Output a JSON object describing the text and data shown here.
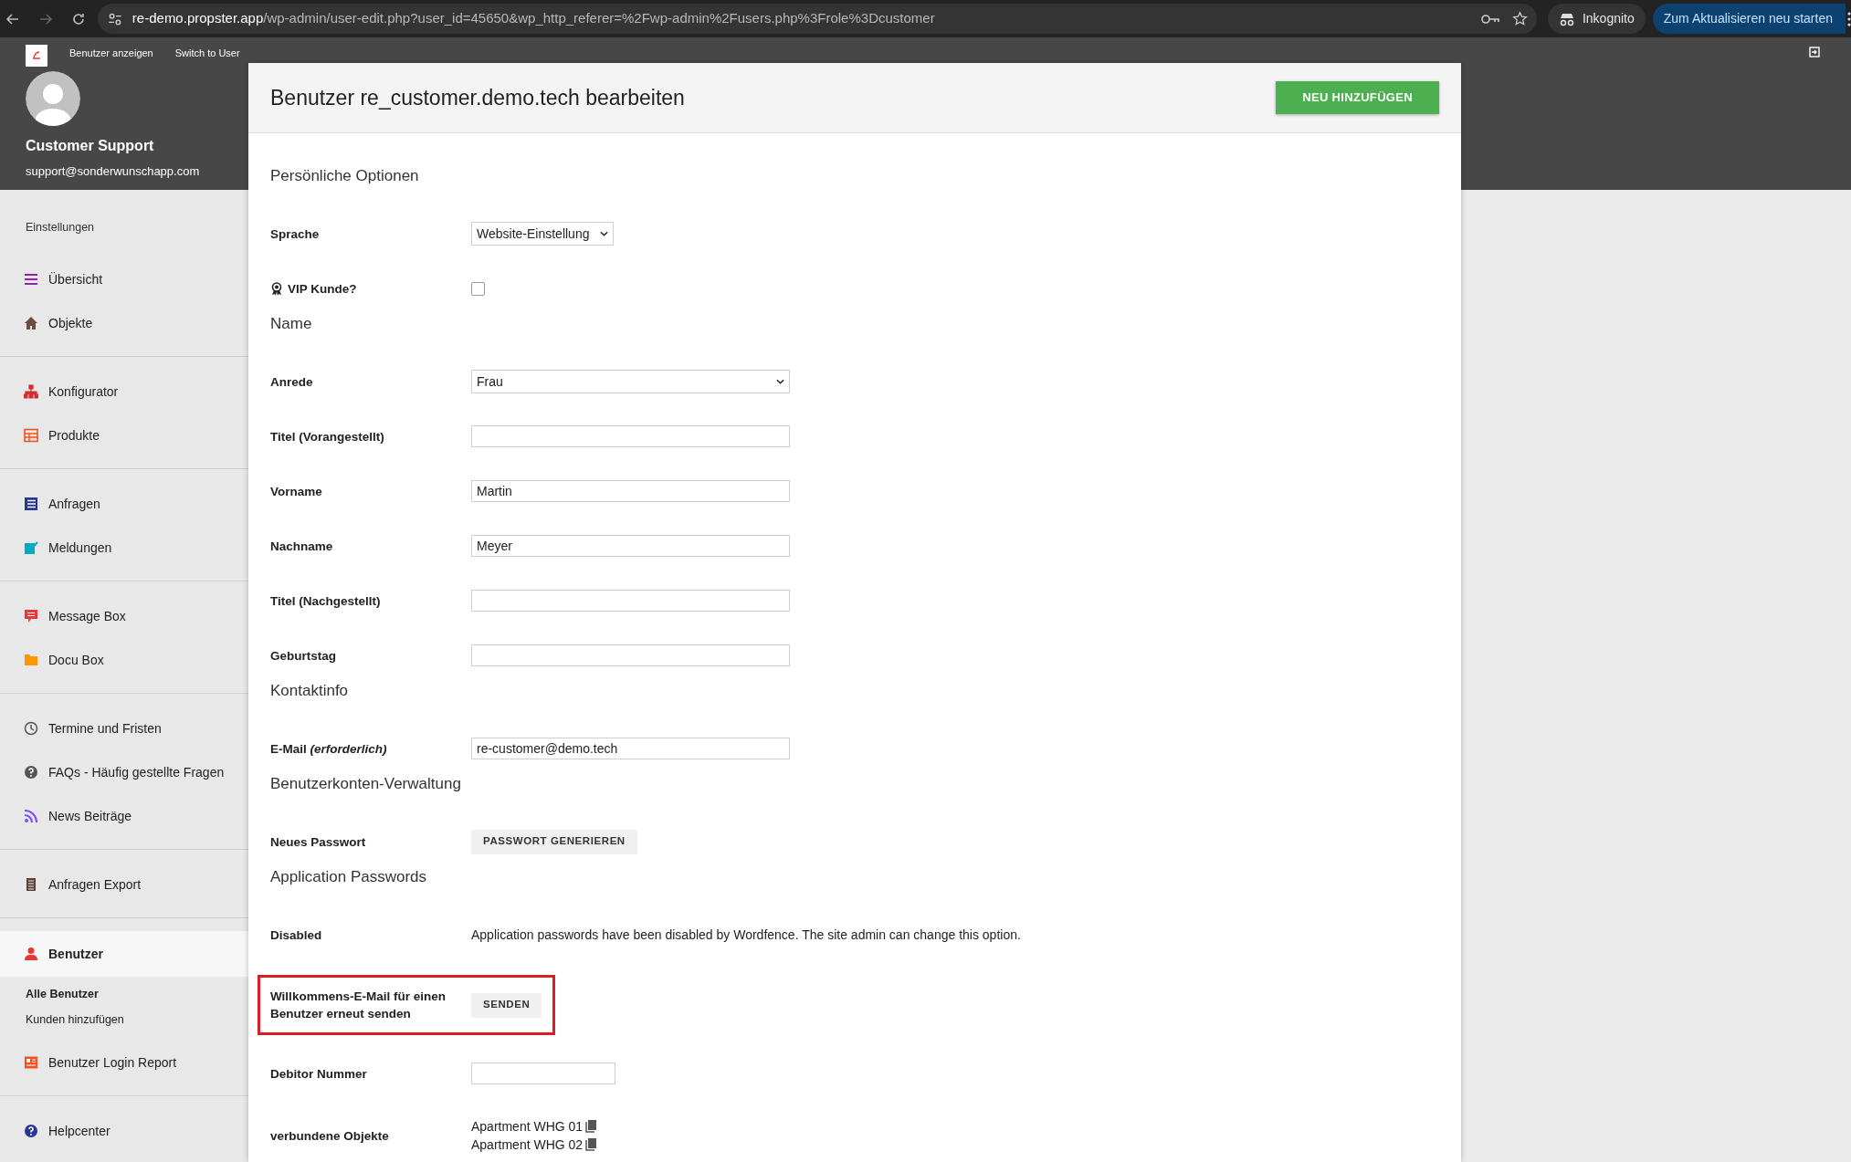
{
  "browser": {
    "url_host": "re-demo.propster.app",
    "url_path": "/wp-admin/user-edit.php?user_id=45650&wp_http_referer=%2Fwp-admin%2Fusers.php%3Frole%3Dcustomer",
    "profile_label": "Inkognito",
    "update_button": "Zum Aktualisieren neu starten"
  },
  "admin_bar": {
    "links": [
      "Benutzer anzeigen",
      "Switch to User"
    ]
  },
  "profile": {
    "name": "Customer Support",
    "email": "support@sonderwunschapp.com"
  },
  "sidebar": {
    "heading": "Einstellungen",
    "groups": [
      [
        {
          "label": "Übersicht",
          "selected": false
        },
        {
          "label": "Objekte",
          "selected": false
        }
      ],
      [
        {
          "label": "Konfigurator",
          "selected": false
        },
        {
          "label": "Produkte",
          "selected": false
        }
      ],
      [
        {
          "label": "Anfragen",
          "selected": false
        },
        {
          "label": "Meldungen",
          "selected": false
        }
      ],
      [
        {
          "label": "Message Box",
          "selected": false
        },
        {
          "label": "Docu Box",
          "selected": false
        }
      ],
      [
        {
          "label": "Termine und Fristen",
          "selected": false
        },
        {
          "label": "FAQs - Häufig gestellte Fragen",
          "selected": false
        },
        {
          "label": "News Beiträge",
          "selected": false
        }
      ],
      [
        {
          "label": "Anfragen Export",
          "selected": false
        }
      ],
      [
        {
          "label": "Benutzer",
          "selected": true,
          "children": [
            {
              "label": "Alle Benutzer",
              "selected": true
            },
            {
              "label": "Kunden hinzufügen",
              "selected": false
            }
          ]
        },
        {
          "label": "Benutzer Login Report",
          "selected": false
        }
      ],
      [
        {
          "label": "Helpcenter",
          "selected": false
        }
      ]
    ]
  },
  "page": {
    "title": "Benutzer re_customer.demo.tech bearbeiten",
    "add_button": "NEU HINZUFÜGEN"
  },
  "form": [
    {
      "kind": "heading",
      "text": "Persönliche Optionen"
    },
    {
      "kind": "dropdown",
      "label": "Sprache",
      "value": "Website-Einstellung"
    },
    {
      "kind": "checkbox",
      "label": "VIP Kunde?",
      "checked": false
    },
    {
      "kind": "heading",
      "text": "Name"
    },
    {
      "kind": "select",
      "label": "Anrede",
      "value": "Frau"
    },
    {
      "kind": "input",
      "label": "Titel (Vorangestellt)"
    },
    {
      "kind": "input",
      "label": "Vorname",
      "value": "Martin"
    },
    {
      "kind": "input",
      "label": "Nachname",
      "value": "Meyer"
    },
    {
      "kind": "input",
      "label": "Titel (Nachgestellt)"
    },
    {
      "kind": "input",
      "label": "Geburtstag"
    },
    {
      "kind": "heading",
      "text": "Kontaktinfo"
    },
    {
      "kind": "input",
      "label": "E-Mail *(erforderlich)*",
      "value": "re-customer@demo.tech"
    },
    {
      "kind": "heading",
      "text": "Benutzerkonten-Verwaltung"
    },
    {
      "kind": "button",
      "label": "Neues Passwort",
      "button": "PASSWORT GENERIEREN",
      "highlighted": false
    },
    {
      "kind": "heading",
      "text": "Application Passwords"
    },
    {
      "kind": "text",
      "label": "Disabled",
      "text": "Application passwords have been disabled by Wordfence. The site admin can change this option."
    },
    {
      "kind": "button",
      "label": "Willkommens-E-Mail für einen Benutzer erneut senden",
      "button": "SENDEN",
      "highlighted": true
    },
    {
      "kind": "number_input",
      "label": "Debitor Nummer"
    },
    {
      "kind": "objects",
      "label": "verbundene Objekte",
      "items": [
        "Apartment WHG 01",
        "Apartment WHG 02"
      ]
    }
  ]
}
